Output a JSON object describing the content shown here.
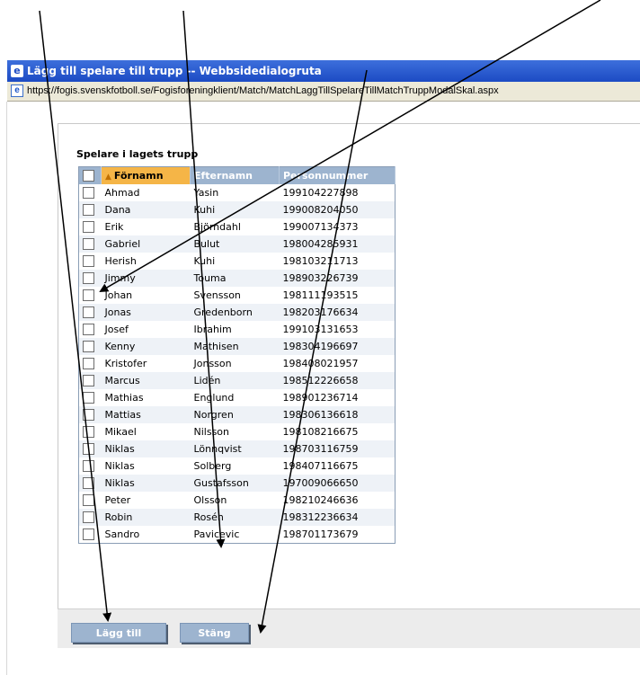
{
  "window": {
    "title": "Lägg till spelare till trupp -- Webbsidedialogruta",
    "url": "https://fogis.svenskfotboll.se/Fogisforeningklient/Match/MatchLaggTillSpelareTillMatchTruppModalSkal.aspx"
  },
  "section": {
    "title": "Spelare i lagets trupp"
  },
  "table": {
    "columns": [
      "Förnamn",
      "Efternamn",
      "Personnummer"
    ],
    "sorted_column": "Förnamn",
    "rows": [
      {
        "first": "Ahmad",
        "last": "Yasin",
        "pnr": "199104227898"
      },
      {
        "first": "Dana",
        "last": "Kuhi",
        "pnr": "199008204050"
      },
      {
        "first": "Erik",
        "last": "Björndahl",
        "pnr": "199007134373"
      },
      {
        "first": "Gabriel",
        "last": "Bulut",
        "pnr": "198004285931"
      },
      {
        "first": "Herish",
        "last": "Kuhi",
        "pnr": "198103211713"
      },
      {
        "first": "Jimmy",
        "last": "Touma",
        "pnr": "198903226739"
      },
      {
        "first": "Johan",
        "last": "Svensson",
        "pnr": "198111193515"
      },
      {
        "first": "Jonas",
        "last": "Gredenborn",
        "pnr": "198203176634"
      },
      {
        "first": "Josef",
        "last": "Ibrahim",
        "pnr": "199103131653"
      },
      {
        "first": "Kenny",
        "last": "Mathisen",
        "pnr": "198304196697"
      },
      {
        "first": "Kristofer",
        "last": "Jonsson",
        "pnr": "198408021957"
      },
      {
        "first": "Marcus",
        "last": "Lidén",
        "pnr": "198512226658"
      },
      {
        "first": "Mathias",
        "last": "Englund",
        "pnr": "198901236714"
      },
      {
        "first": "Mattias",
        "last": "Norgren",
        "pnr": "198306136618"
      },
      {
        "first": "Mikael",
        "last": "Nilsson",
        "pnr": "198108216675"
      },
      {
        "first": "Niklas",
        "last": "Lönnqvist",
        "pnr": "198703116759"
      },
      {
        "first": "Niklas",
        "last": "Solberg",
        "pnr": "198407116675"
      },
      {
        "first": "Niklas",
        "last": "Gustafsson",
        "pnr": "197009066650"
      },
      {
        "first": "Peter",
        "last": "Olsson",
        "pnr": "198210246636"
      },
      {
        "first": "Robin",
        "last": "Rosén",
        "pnr": "198312236634"
      },
      {
        "first": "Sandro",
        "last": "Pavicevic",
        "pnr": "198701173679"
      }
    ]
  },
  "buttons": {
    "add_label": "Lägg till",
    "close_label": "Stäng"
  },
  "colors": {
    "titlebar": "#1c4bc4",
    "header": "#9db4cf",
    "sorted_header": "#f5b547",
    "button": "#9db4cf"
  }
}
